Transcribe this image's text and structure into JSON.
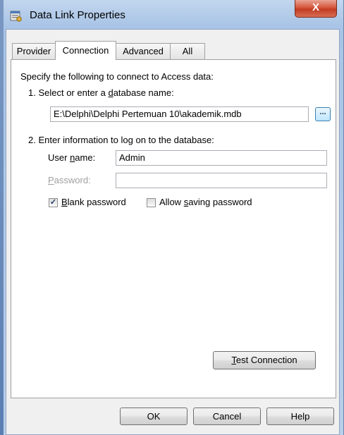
{
  "window": {
    "title": "Data Link Properties",
    "close_label": "X"
  },
  "tabs": [
    {
      "label": "Provider"
    },
    {
      "label": "Connection",
      "active": true
    },
    {
      "label": "Advanced"
    },
    {
      "label": "All"
    }
  ],
  "connection": {
    "intro": "Specify the following to connect to Access data:",
    "step1_prefix": "1. Select or enter a ",
    "step1_accel": "d",
    "step1_suffix": "atabase name:",
    "database_path": "E:\\Delphi\\Delphi Pertemuan 10\\akademik.mdb",
    "browse_label": "...",
    "step2": "2. Enter information to log on to the database:",
    "username_prefix": "User ",
    "username_accel": "n",
    "username_suffix": "ame:",
    "username_value": "Admin",
    "password_accel": "P",
    "password_suffix": "assword:",
    "password_value": "",
    "blank_password": {
      "accel": "B",
      "suffix": "lank password",
      "checked": true,
      "mark": "✓"
    },
    "allow_saving": {
      "prefix": "Allow ",
      "accel": "s",
      "suffix": "aving password",
      "checked": false
    },
    "test_accel": "T",
    "test_suffix": "est Connection"
  },
  "footer": {
    "ok_label": "OK",
    "cancel_label": "Cancel",
    "help_label": "Help"
  },
  "colors": {
    "title_gradient": "#b9cfea",
    "close_button": "#c23c22",
    "dialog_bg": "#f0f0f0",
    "panel_bg": "#ffffff"
  }
}
